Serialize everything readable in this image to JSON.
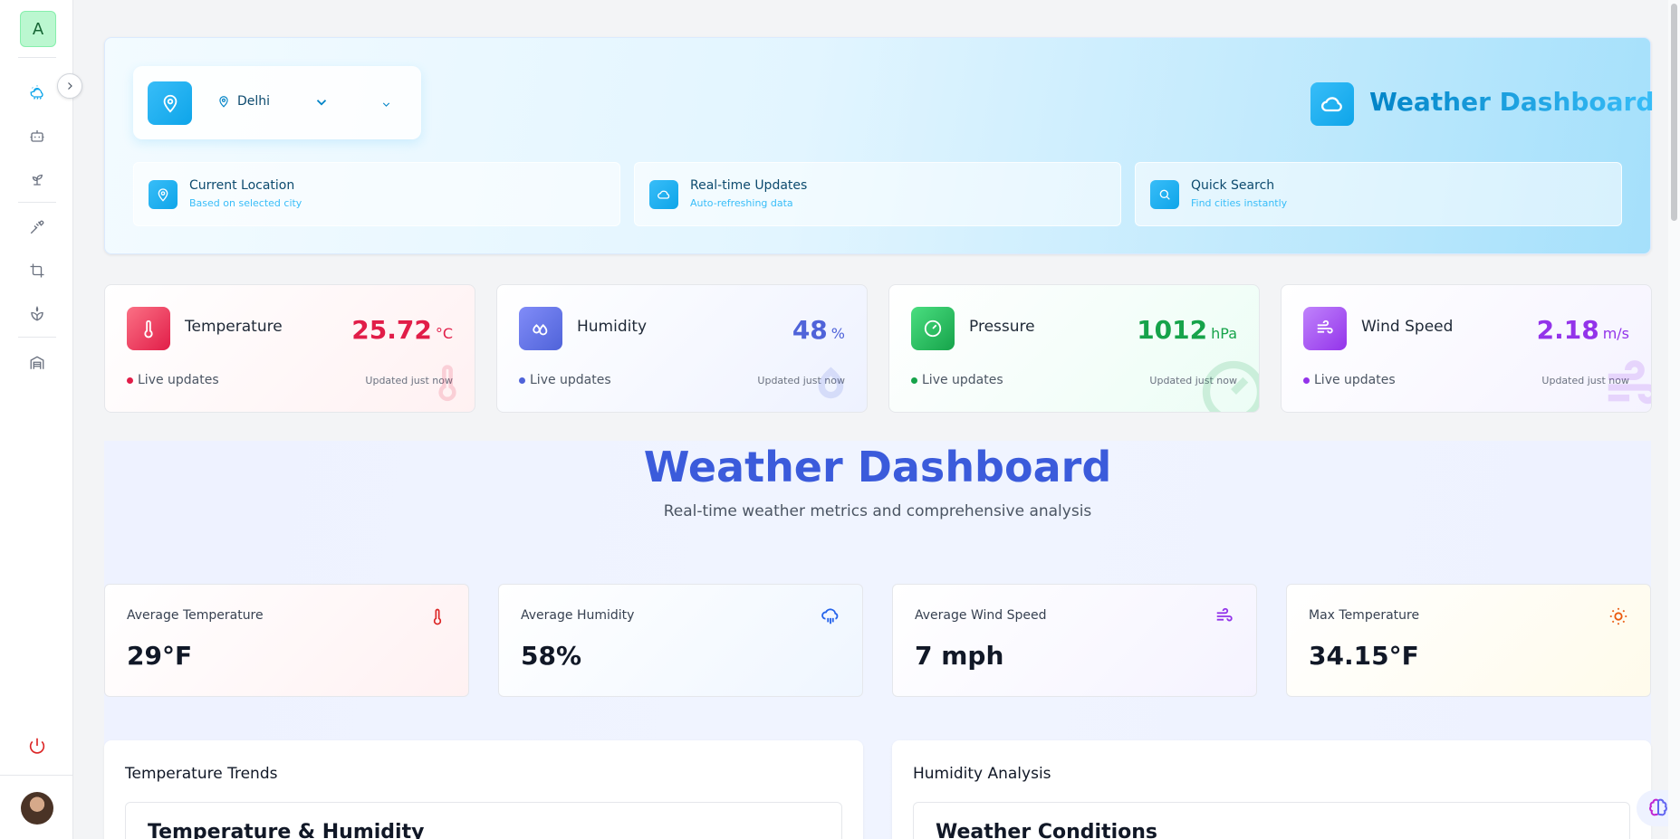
{
  "sidebar": {
    "logo_letter": "A",
    "icons": [
      "weather-icon",
      "robot-icon",
      "sprout-icon",
      "wheat-icon",
      "crop-icon",
      "leaf-icon",
      "warehouse-icon"
    ]
  },
  "location": {
    "city": "Delhi"
  },
  "header": {
    "title": "Weather Dashboard"
  },
  "features": [
    {
      "title": "Current Location",
      "subtitle": "Based on selected city"
    },
    {
      "title": "Real-time Updates",
      "subtitle": "Auto-refreshing data"
    },
    {
      "title": "Quick Search",
      "subtitle": "Find cities instantly"
    }
  ],
  "metrics": [
    {
      "label": "Temperature",
      "value": "25.72",
      "unit": "°C",
      "live": "Live updates",
      "updated": "Updated just now",
      "color": "#e11d48"
    },
    {
      "label": "Humidity",
      "value": "48",
      "unit": "%",
      "live": "Live updates",
      "updated": "Updated just now",
      "color": "#4f63d9"
    },
    {
      "label": "Pressure",
      "value": "1012",
      "unit": "hPa",
      "live": "Live updates",
      "updated": "Updated just now",
      "color": "#16a34a"
    },
    {
      "label": "Wind Speed",
      "value": "2.18",
      "unit": "m/s",
      "live": "Live updates",
      "updated": "Updated just now",
      "color": "#9333ea"
    }
  ],
  "section": {
    "title": "Weather Dashboard",
    "subtitle": "Real-time weather metrics and comprehensive analysis"
  },
  "averages": [
    {
      "label": "Average Temperature",
      "value": "29°F"
    },
    {
      "label": "Average Humidity",
      "value": "58%"
    },
    {
      "label": "Average Wind Speed",
      "value": "7 mph"
    },
    {
      "label": "Max Temperature",
      "value": "34.15°F"
    }
  ],
  "panels": [
    {
      "title": "Temperature Trends",
      "inner_title": "Temperature & Humidity"
    },
    {
      "title": "Humidity Analysis",
      "inner_title": "Weather Conditions"
    }
  ]
}
